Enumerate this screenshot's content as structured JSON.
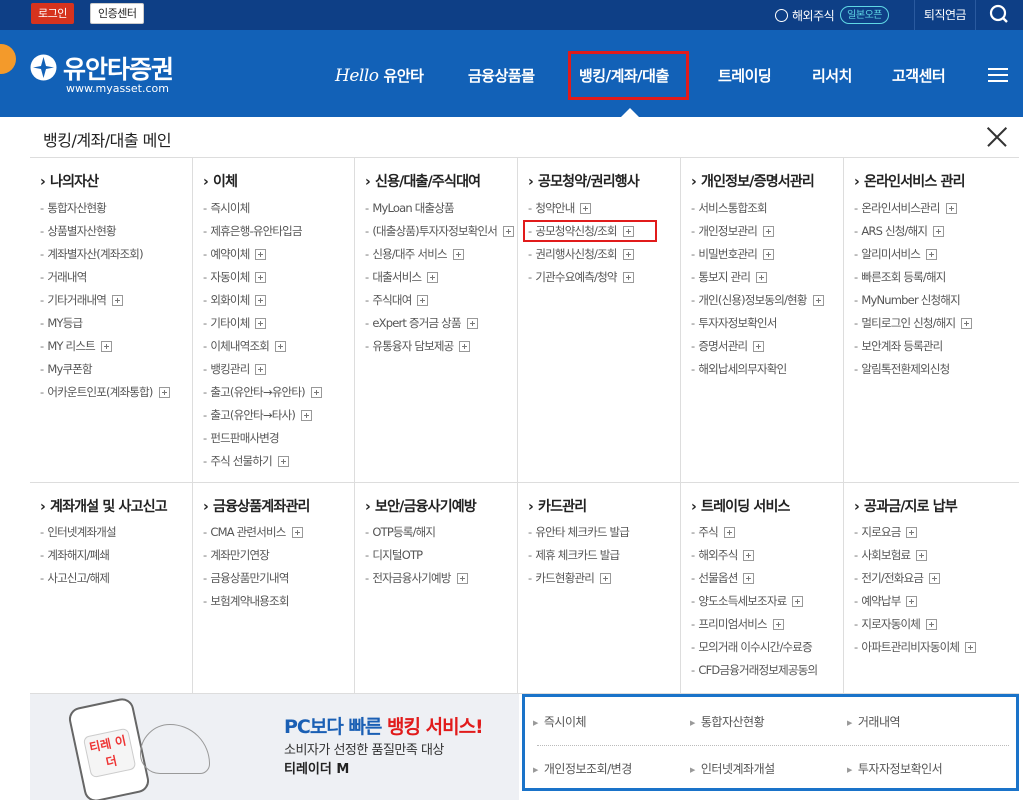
{
  "topbar": {
    "login_label": "로그인",
    "cert_label": "인증센터",
    "overseas_label": "해외주식",
    "overseas_badge": "일본오픈",
    "retire_label": "퇴직연금"
  },
  "header": {
    "logo_name": "유안타증권",
    "logo_url": "www.myasset.com",
    "nav": [
      {
        "hello": "Hello",
        "label": "유안타"
      },
      {
        "label": "금융상품몰"
      },
      {
        "label": "뱅킹/계좌/대출"
      },
      {
        "label": "트레이딩"
      },
      {
        "label": "리서치"
      },
      {
        "label": "고객센터"
      }
    ]
  },
  "panel": {
    "title": "뱅킹/계좌/대출 메인",
    "row1": [
      {
        "head": "나의자산",
        "items": [
          "통합자산현황",
          "상품별자산현황",
          "계좌별자산(계좌조회)",
          "거래내역",
          "기타거래내역",
          "MY등급",
          "MY 리스트",
          "My쿠폰함",
          "어카운트인포(계좌통합)"
        ]
      },
      {
        "head": "이체",
        "items": [
          "즉시이체",
          "제휴은행-유안타입금",
          "예약이체",
          "자동이체",
          "외화이체",
          "기타이체",
          "이체내역조회",
          "뱅킹관리",
          "출고(유안타→유안타)",
          "출고(유안타→타사)",
          "펀드판매사변경",
          "주식 선물하기"
        ]
      },
      {
        "head": "신용/대출/주식대여",
        "items": [
          "MyLoan 대출상품",
          "(대출상품)투자자정보확인서",
          "신용/대주 서비스",
          "대출서비스",
          "주식대여",
          "eXpert 증거금 상품",
          "유통융자 담보제공"
        ]
      },
      {
        "head": "공모청약/권리행사",
        "items": [
          "청약안내",
          "공모청약신청/조회",
          "권리행사신청/조회",
          "기관수요예측/청약"
        ]
      },
      {
        "head": "개인정보/증명서관리",
        "items": [
          "서비스통합조회",
          "개인정보관리",
          "비밀번호관리",
          "통보지 관리",
          "개인(신용)정보동의/현황",
          "투자자정보확인서",
          "증명서관리",
          "해외납세의무자확인"
        ]
      },
      {
        "head": "온라인서비스 관리",
        "items": [
          "온라인서비스관리",
          "ARS 신청/해지",
          "알리미서비스",
          "빠른조회 등록/해지",
          "MyNumber 신청해지",
          "멀티로그인 신청/해지",
          "보안계좌 등록관리",
          "알림톡전환제외신청"
        ]
      }
    ],
    "row2": [
      {
        "head": "계좌개설 및 사고신고",
        "items": [
          "인터넷계좌개설",
          "계좌해지/폐쇄",
          "사고신고/해제"
        ]
      },
      {
        "head": "금융상품계좌관리",
        "items": [
          "CMA 관련서비스",
          "계좌만기연장",
          "금융상품만기내역",
          "보험계약내용조회"
        ]
      },
      {
        "head": "보안/금융사기예방",
        "items": [
          "OTP등록/해지",
          "디지털OTP",
          "전자금융사기예방"
        ]
      },
      {
        "head": "카드관리",
        "items": [
          "유안타 체크카드 발급",
          "제휴 체크카드 발급",
          "카드현황관리"
        ]
      },
      {
        "head": "트레이딩 서비스",
        "items": [
          "주식",
          "해외주식",
          "선물옵션",
          "양도소득세보조자료",
          "프리미엄서비스",
          "모의거래 이수시간/수료증",
          "CFD금융거래정보제공동의"
        ]
      },
      {
        "head": "공과금/지로 납부",
        "items": [
          "지로요금",
          "사회보험료",
          "전기/전화요금",
          "예약납부",
          "지로자동이체",
          "아파트관리비자동이체"
        ]
      }
    ]
  },
  "promo": {
    "badge": "티레 이더",
    "title_a": "PC보다 빠른 ",
    "title_b": "뱅킹 서비스!",
    "subtitle": "소비자가 선정한 품질만족 대상",
    "name": "티레이더 M"
  },
  "quick": {
    "links": [
      "즉시이체",
      "통합자산현황",
      "거래내역",
      "개인정보조회/변경",
      "인터넷계좌개설",
      "투자자정보확인서"
    ]
  }
}
